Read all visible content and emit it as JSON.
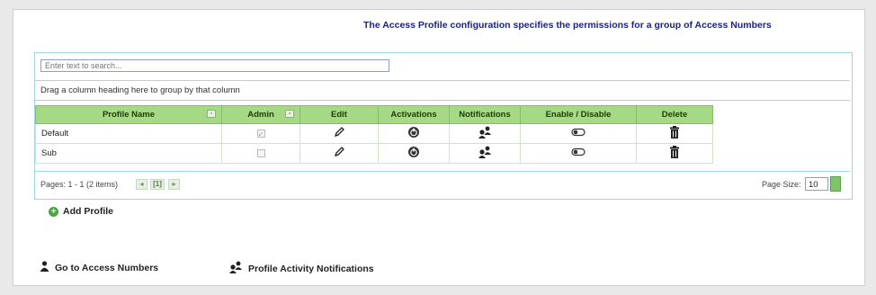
{
  "header": {
    "message": "The Access Profile configuration specifies the permissions for a group of Access Numbers"
  },
  "search": {
    "placeholder": "Enter text to search..."
  },
  "group_hint": "Drag a column heading here to group by that column",
  "columns": [
    "Profile Name",
    "Admin",
    "Edit",
    "Activations",
    "Notifications",
    "Enable / Disable",
    "Delete"
  ],
  "rows": [
    {
      "name": "Default",
      "admin": true
    },
    {
      "name": "Sub",
      "admin": false
    }
  ],
  "icons": {
    "edit": "pencil-icon",
    "activations": "power-icon",
    "notifications": "users-icon",
    "enable": "toggle-icon",
    "delete": "trash-icon"
  },
  "pager": {
    "summary": "Pages: 1 - 1 (2 items)",
    "current_page": "[1]",
    "page_size_label": "Page Size:",
    "page_size": "10"
  },
  "actions": {
    "add_profile": "Add Profile",
    "go_to_access_numbers": "Go to Access Numbers",
    "profile_activity_notifications": "Profile Activity Notifications"
  },
  "colors": {
    "header_text": "#1a237e",
    "grid_header_bg": "#a6d984",
    "grid_border": "#9fd7dc",
    "add_icon": "#4aa843"
  }
}
